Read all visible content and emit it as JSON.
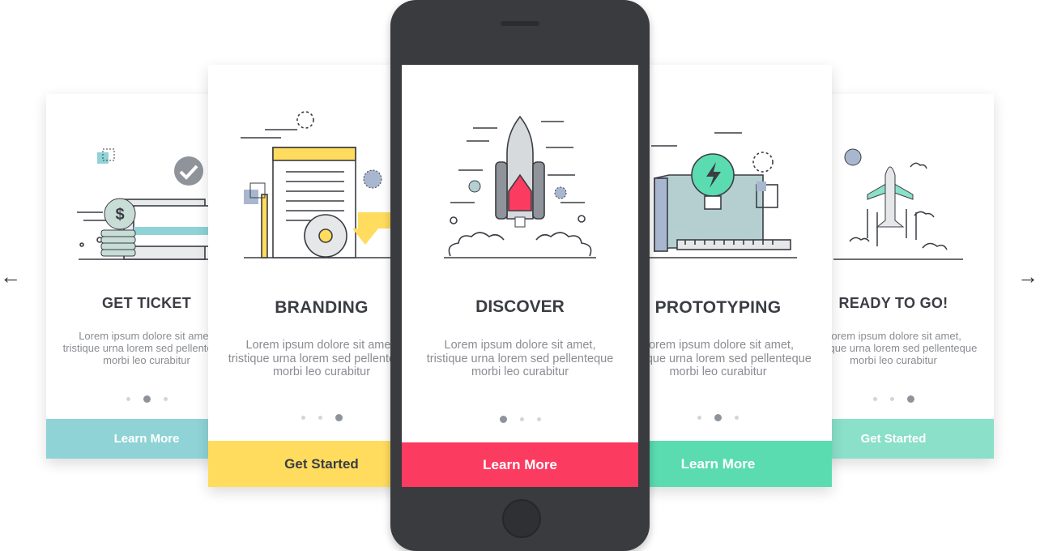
{
  "colors": {
    "teal": "#8fd3d6",
    "yellow": "#ffdc5e",
    "pink": "#fb3b60",
    "green": "#5adcb0",
    "mint": "#8ae0c9",
    "phone": "#3a3b3f",
    "title": "#3b3d44",
    "desc": "#8a8c92"
  },
  "nav": {
    "prev_arrow": "←",
    "next_arrow": "→"
  },
  "cards": [
    {
      "id": "get-ticket",
      "illustration": "ticket-money-icon",
      "title": "GET TICKET",
      "desc": [
        "Lorem ipsum dolore sit amet,",
        "tristique urna lorem sed pellenteque",
        "morbi leo curabitur"
      ],
      "active_dot": 2,
      "cta": "Learn More",
      "cta_color": "#8fd3d6",
      "cta_text_color": "#ffffff"
    },
    {
      "id": "branding",
      "illustration": "branding-document-icon",
      "title": "BRANDING",
      "desc": [
        "Lorem ipsum dolore sit amet,",
        "tristique urna lorem sed pellenteque",
        "morbi leo curabitur"
      ],
      "active_dot": 3,
      "cta": "Get Started",
      "cta_color": "#ffdc5e",
      "cta_text_color": "#3b3d44"
    },
    {
      "id": "discover",
      "illustration": "rocket-launch-icon",
      "title": "DISCOVER",
      "desc": [
        "Lorem ipsum dolore sit amet,",
        "tristique urna lorem sed pellenteque",
        "morbi leo curabitur"
      ],
      "active_dot": 1,
      "cta": "Learn More",
      "cta_color": "#fb3b60",
      "cta_text_color": "#ffffff"
    },
    {
      "id": "prototyping",
      "illustration": "lightbulb-blueprint-icon",
      "title": "PROTOTYPING",
      "desc": [
        "Lorem ipsum dolore sit amet,",
        "tristique urna lorem sed pellenteque",
        "morbi leo curabitur"
      ],
      "active_dot": 2,
      "cta": "Learn More",
      "cta_color": "#5adcb0",
      "cta_text_color": "#ffffff"
    },
    {
      "id": "ready-to-go",
      "illustration": "airplane-icon",
      "title": "READY TO GO!",
      "desc": [
        "Lorem ipsum dolore sit amet,",
        "tristique urna lorem sed pellenteque",
        "morbi leo curabitur"
      ],
      "active_dot": 3,
      "cta": "Get Started",
      "cta_color": "#8ae0c9",
      "cta_text_color": "#ffffff"
    }
  ]
}
